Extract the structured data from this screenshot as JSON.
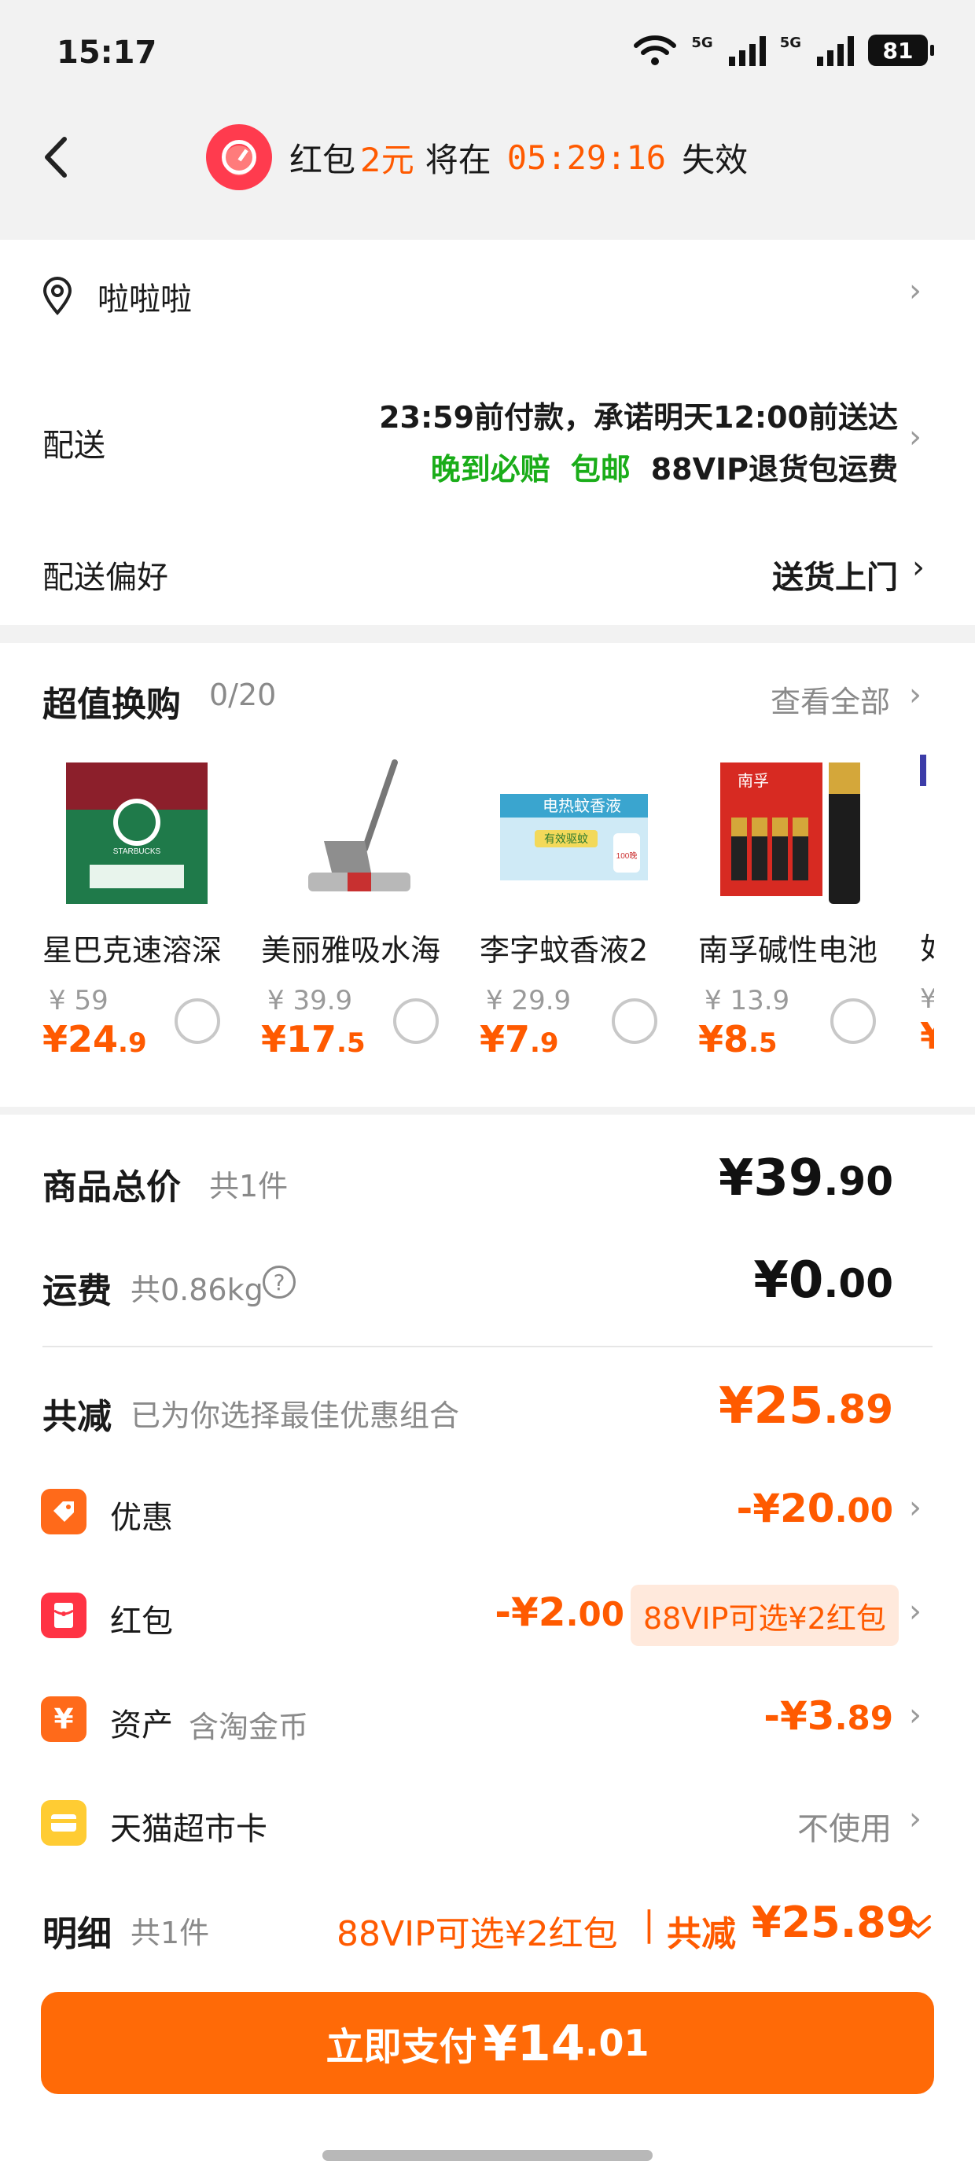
{
  "status_bar": {
    "time": "15:17",
    "network_1": "5G",
    "network_2": "5G",
    "battery": "81"
  },
  "header": {
    "banner_prefix": "红包",
    "banner_amount": "2元",
    "banner_middle": "将在",
    "countdown": "05:29:16",
    "banner_suffix": "失效"
  },
  "address": {
    "name": "啦啦啦"
  },
  "delivery": {
    "label": "配送",
    "promise": "23:59前付款，承诺明天12:00前送达",
    "tag_late": "晚到必赔",
    "tag_free": "包邮",
    "tag_vip": "88VIP退货包运费"
  },
  "delivery_pref": {
    "label": "配送偏好",
    "value": "送货上门"
  },
  "exchange": {
    "title": "超值换购",
    "count": "0/20",
    "view_all": "查看全部",
    "products": [
      {
        "name": "星巴克速溶深",
        "orig": "¥ 59",
        "price_int": "¥24",
        "price_dec": ".9"
      },
      {
        "name": "美丽雅吸水海",
        "orig": "¥ 39.9",
        "price_int": "¥17",
        "price_dec": ".5"
      },
      {
        "name": "李字蚊香液2",
        "orig": "¥ 29.9",
        "price_int": "¥7",
        "price_dec": ".9"
      },
      {
        "name": "南孚碱性电池",
        "orig": "¥ 13.9",
        "price_int": "¥8",
        "price_dec": ".5"
      }
    ],
    "product_text": {
      "starbucks_brand": "STARBUCKS",
      "mosquito_title": "电热蚊香液",
      "mosquito_badge": "有效驱蚊",
      "mosquito_count": "100晚",
      "battery_brand": "南孚"
    },
    "partial_next_name": "如",
    "partial_next_orig": "¥",
    "partial_next_price": "¥"
  },
  "summary": {
    "goods_label": "商品总价",
    "goods_count": "共1件",
    "goods_int": "¥39",
    "goods_dec": ".90",
    "shipping_label": "运费",
    "shipping_weight": "共0.86kg",
    "shipping_help": "?",
    "shipping_int": "¥0",
    "shipping_dec": ".00",
    "reduce_label": "共减",
    "reduce_note": "已为你选择最佳优惠组合",
    "reduce_int": "¥25",
    "reduce_dec": ".89"
  },
  "discounts": [
    {
      "label": "优惠",
      "amount_int": "-¥20",
      "amount_dec": ".00"
    },
    {
      "label": "红包",
      "amount_int": "-¥2",
      "amount_dec": ".00",
      "badge": "88VIP可选¥2红包"
    },
    {
      "label": "资产",
      "sub": "含淘金币",
      "amount_int": "-¥3",
      "amount_dec": ".89"
    },
    {
      "label": "天猫超市卡",
      "value": "不使用"
    }
  ],
  "detail": {
    "label": "明细",
    "count": "共1件",
    "vip_note": "88VIP可选¥2红包",
    "divider": "|",
    "total_label": "共减",
    "total_value": "¥25.89"
  },
  "pay": {
    "label": "立即支付",
    "int": "¥14",
    "dec": ".01"
  },
  "colors": {
    "accent": "#ff5a00",
    "green": "#1aad19",
    "pay_button": "#ff6a07"
  },
  "icons": [
    "back-icon",
    "stopwatch-icon",
    "location-pin-icon",
    "chevron-right-icon",
    "help-icon",
    "tag-icon",
    "red-packet-icon",
    "yen-icon",
    "card-icon",
    "chevron-double-down-icon"
  ]
}
